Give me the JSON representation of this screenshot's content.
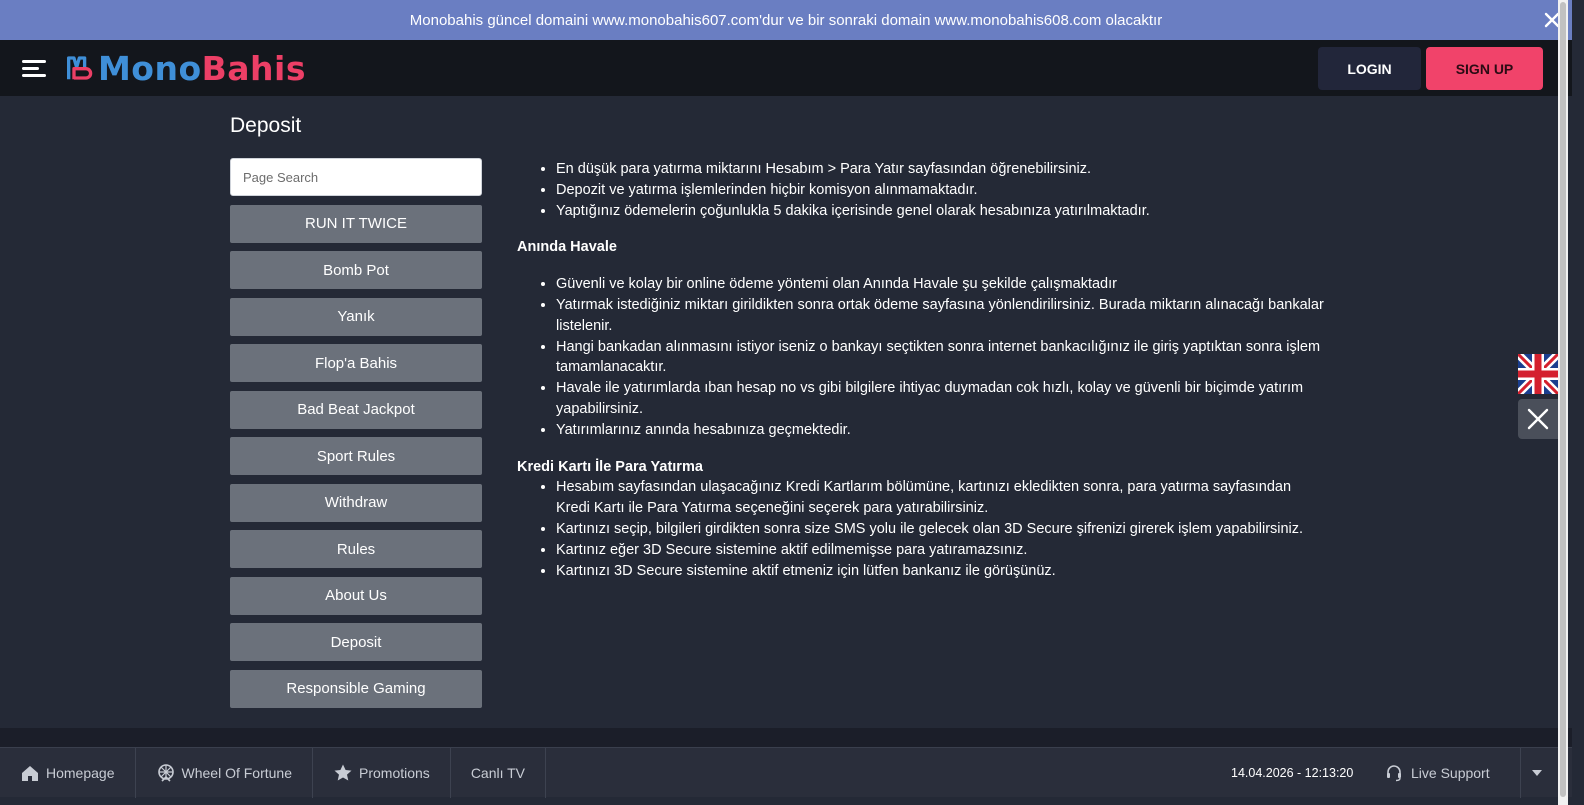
{
  "notice": {
    "text": "Monobahis güncel domaini www.monobahis607.com'dur ve bir sonraki domain www.monobahis608.com olacaktır"
  },
  "header": {
    "logo_mono": "Mono",
    "logo_bahis": "Bahis",
    "login_label": "LOGIN",
    "signup_label": "SIGN UP"
  },
  "page": {
    "title": "Deposit"
  },
  "sidebar": {
    "search_placeholder": "Page Search",
    "items": [
      {
        "label": "RUN IT TWICE"
      },
      {
        "label": "Bomb Pot"
      },
      {
        "label": "Yanık"
      },
      {
        "label": "Flop'a Bahis"
      },
      {
        "label": "Bad Beat Jackpot"
      },
      {
        "label": "Sport Rules"
      },
      {
        "label": "Withdraw"
      },
      {
        "label": "Rules"
      },
      {
        "label": "About Us"
      },
      {
        "label": "Deposit"
      },
      {
        "label": "Responsible Gaming"
      }
    ]
  },
  "content": {
    "intro_bullets": [
      "En düşük para yatırma miktarını Hesabım > Para Yatır sayfasından öğrenebilirsiniz.",
      "Depozit ve yatırma işlemlerinden hiçbir komisyon alınmamaktadır.",
      "Yaptığınız ödemelerin çoğunlukla 5 dakika içerisinde genel olarak hesabınıza yatırılmaktadır."
    ],
    "section1_title": "Anında Havale",
    "section1_bullets": [
      "Güvenli ve kolay bir online ödeme yöntemi olan Anında Havale şu şekilde çalışmaktadır",
      "Yatırmak istediğiniz miktarı girildikten sonra ortak ödeme sayfasına yönlendirilirsiniz. Burada miktarın alınacağı bankalar listelenir.",
      "Hangi bankadan alınmasını istiyor iseniz o bankayı seçtikten sonra internet bankacılığınız ile giriş yaptıktan sonra işlem tamamlanacaktır.",
      "Havale ile yatırımlarda ıban hesap no vs gibi bilgilere ihtiyac duymadan cok hızlı, kolay ve güvenli  bir biçimde yatırım yapabilirsiniz.",
      "Yatırımlarınız anında hesabınıza geçmektedir."
    ],
    "section2_title": "Kredi Kartı İle Para Yatırma",
    "section2_bullets": [
      "Hesabım sayfasından ulaşacağınız Kredi Kartlarım bölümüne, kartınızı ekledikten sonra, para yatırma sayfasından Kredi Kartı ile Para Yatırma seçeneğini seçerek para yatırabilirsiniz.",
      "Kartınızı seçip, bilgileri girdikten sonra size SMS yolu ile gelecek olan 3D Secure şifrenizi girerek işlem yapabilirsiniz.",
      "Kartınız eğer 3D Secure sistemine aktif edilmemişse para yatıramazsınız.",
      "Kartınızı 3D Secure sistemine aktif etmeniz için lütfen bankanız ile görüşünüz."
    ]
  },
  "bottombar": {
    "homepage": "Homepage",
    "wheel": "Wheel Of Fortune",
    "promotions": "Promotions",
    "canli_tv": "Canlı TV",
    "datetime": "14.04.2026 - 12:13:20",
    "live_support": "Live Support"
  },
  "icons": {
    "notice_close": "close-icon",
    "menu": "hamburger-menu-icon",
    "home": "home-icon",
    "wheel": "wheel-icon",
    "promotions": "star-icon",
    "support": "headset-icon",
    "caret": "caret-down-icon",
    "language": "uk-flag-icon",
    "widget_close": "close-icon"
  },
  "colors": {
    "notice_bg": "#6a7ec2",
    "header_bg": "#13161c",
    "page_bg": "#242936",
    "logo_blue": "#3f8fd8",
    "logo_pink": "#ec3f66",
    "signup_bg": "#f1436a",
    "login_bg": "#22263a",
    "sidebar_btn_bg": "#6b717b"
  }
}
